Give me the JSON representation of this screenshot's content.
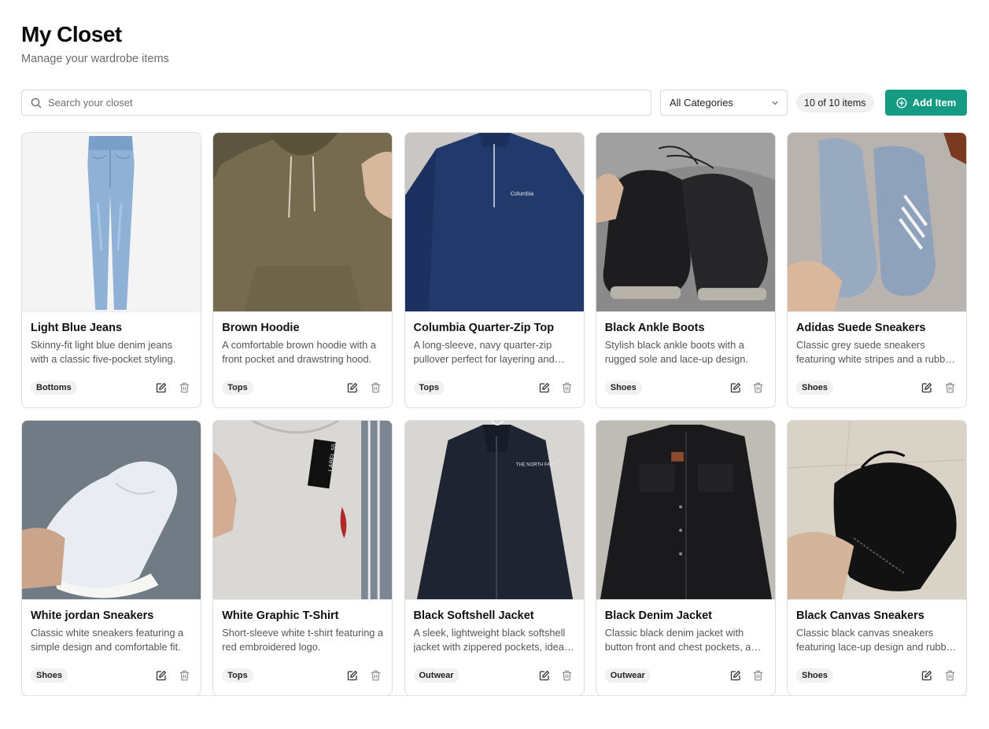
{
  "header": {
    "title": "My Closet",
    "subtitle": "Manage your wardrobe items"
  },
  "toolbar": {
    "search_placeholder": "Search your closet",
    "category_selected": "All Categories",
    "count_text": "10 of 10 items",
    "add_label": "Add Item"
  },
  "colors": {
    "accent": "#159b83"
  },
  "items": [
    {
      "name": "Light Blue Jeans",
      "description": "Skinny-fit light blue denim jeans with a classic five-pocket styling.",
      "category": "Bottoms",
      "photo": "jeans"
    },
    {
      "name": "Brown Hoodie",
      "description": "A comfortable brown hoodie with a front pocket and drawstring hood.",
      "category": "Tops",
      "photo": "hoodie"
    },
    {
      "name": "Columbia Quarter-Zip Top",
      "description": "A long-sleeve, navy quarter-zip pullover perfect for layering and outdoor wear.",
      "category": "Tops",
      "photo": "quarterzip"
    },
    {
      "name": "Black Ankle Boots",
      "description": "Stylish black ankle boots with a rugged sole and lace-up design.",
      "category": "Shoes",
      "photo": "boots"
    },
    {
      "name": "Adidas Suede Sneakers",
      "description": "Classic grey suede sneakers featuring white stripes and a rubber sole.",
      "category": "Shoes",
      "photo": "suede"
    },
    {
      "name": "White jordan Sneakers",
      "description": "Classic white sneakers featuring a simple design and comfortable fit.",
      "category": "Shoes",
      "photo": "whitesneaker"
    },
    {
      "name": "White Graphic T-Shirt",
      "description": "Short-sleeve white t-shirt featuring a red embroidered logo.",
      "category": "Tops",
      "photo": "tshirt"
    },
    {
      "name": "Black Softshell Jacket",
      "description": "A sleek, lightweight black softshell jacket with zippered pockets, ideal for outdoor wear.",
      "category": "Outwear",
      "photo": "softshell"
    },
    {
      "name": "Black Denim Jacket",
      "description": "Classic black denim jacket with button front and chest pockets, a timeless layer.",
      "category": "Outwear",
      "photo": "denimjacket"
    },
    {
      "name": "Black Canvas Sneakers",
      "description": "Classic black canvas sneakers featuring lace-up design and rubber sole.",
      "category": "Shoes",
      "photo": "canvas"
    }
  ]
}
